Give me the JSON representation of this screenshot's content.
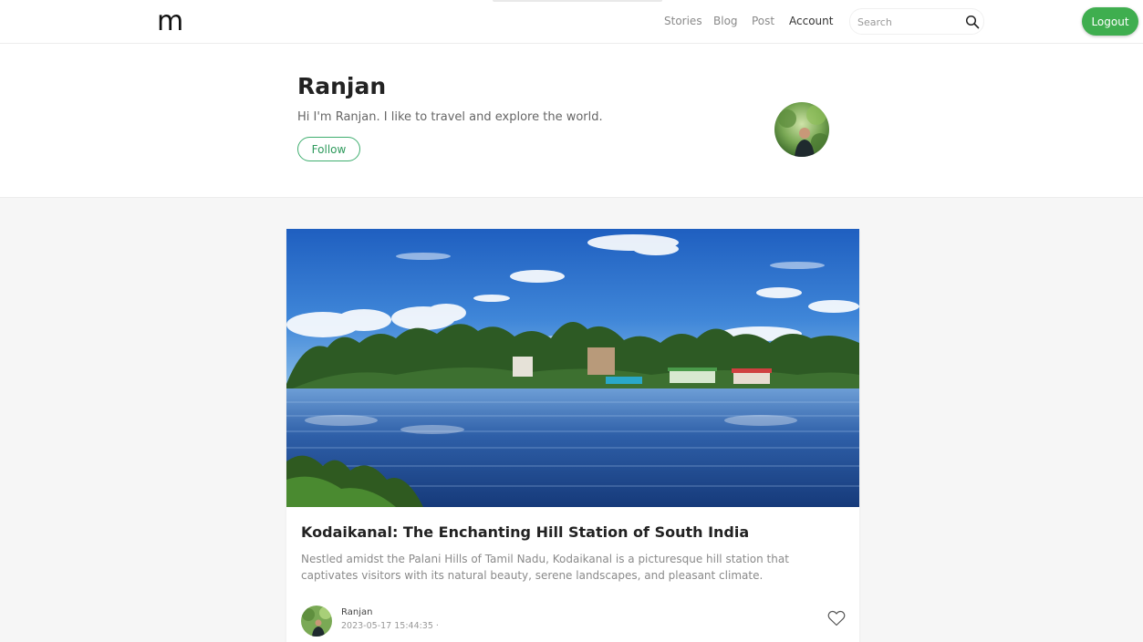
{
  "nav": {
    "logo": "m",
    "links": [
      "Stories",
      "Blog",
      "Post",
      "Account"
    ],
    "search_placeholder": "Search",
    "logout_label": "Logout"
  },
  "profile": {
    "name": "Ranjan",
    "bio": "Hi I'm Ranjan. I like to travel and explore the world.",
    "follow_label": "Follow"
  },
  "post": {
    "title": "Kodaikanal: The Enchanting Hill Station of South India",
    "excerpt": "Nestled amidst the Palani Hills of Tamil Nadu, Kodaikanal is a picturesque hill station that captivates visitors with its natural beauty, serene landscapes, and pleasant climate.",
    "author": "Ranjan",
    "date": "2023-05-17 15:44:35 ·"
  },
  "colors": {
    "accent_green": "#3fae4f",
    "follow_green": "#2e9a5c",
    "background": "#f6f6f6"
  },
  "icons": [
    "search-icon",
    "heart-icon"
  ]
}
